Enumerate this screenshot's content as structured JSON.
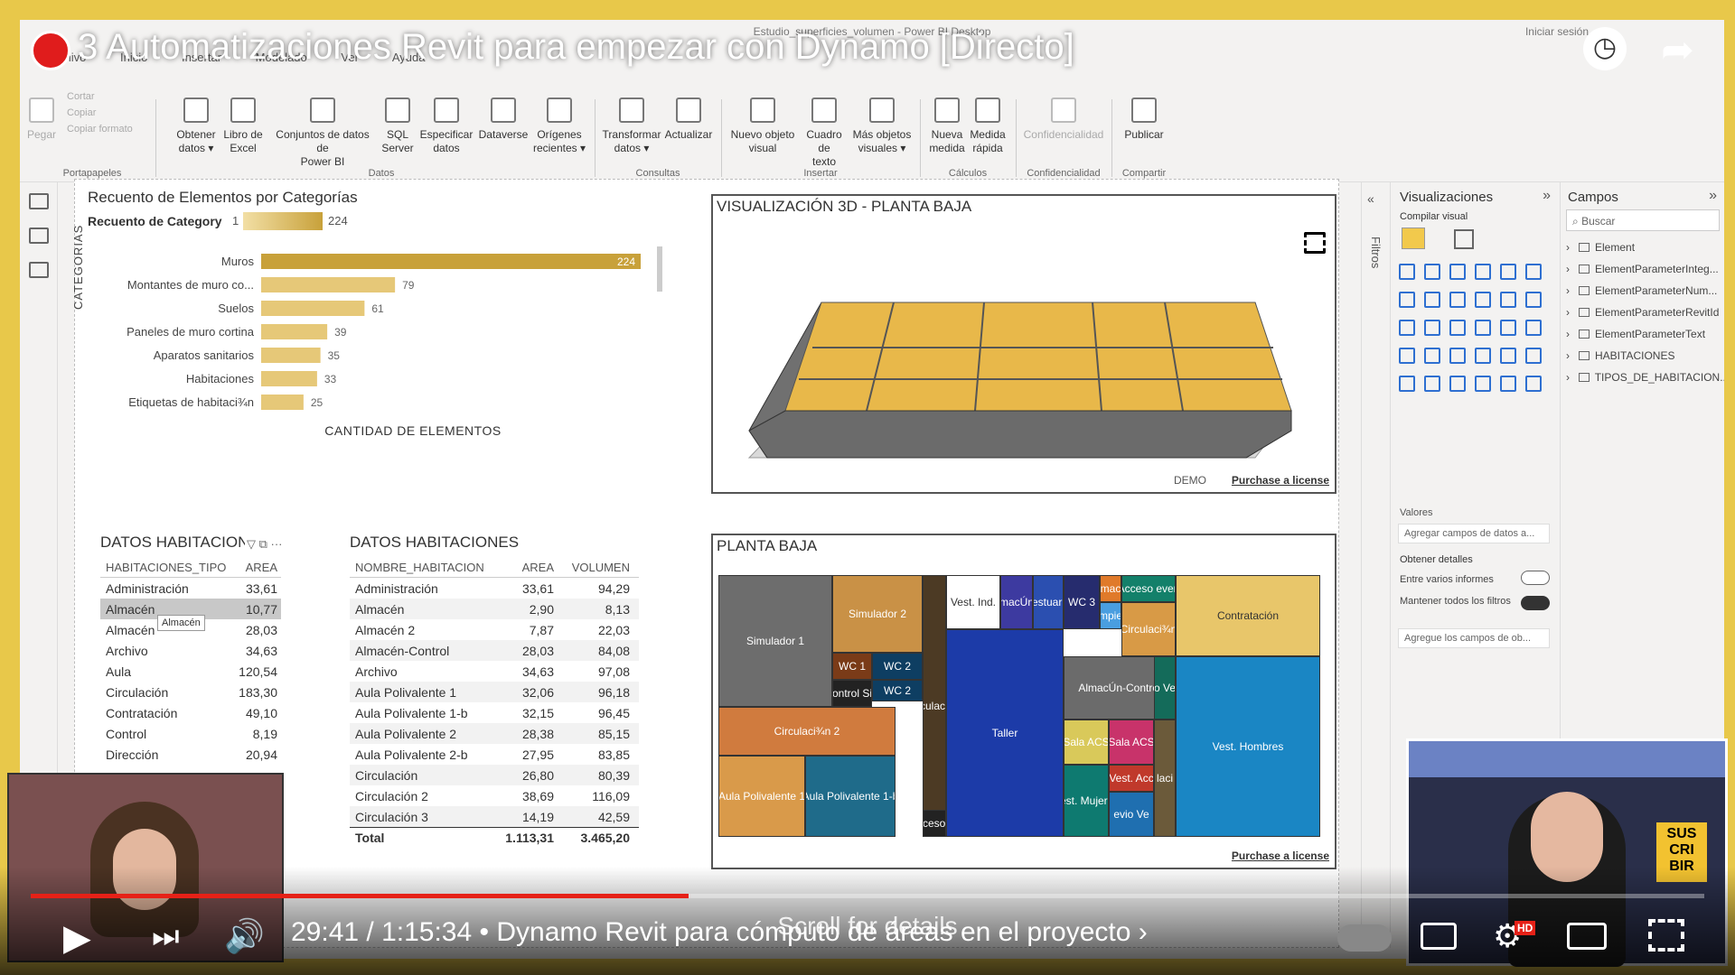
{
  "window": {
    "title": "Estudio_superficies_volumen - Power BI Desktop",
    "session": "Iniciar sesión"
  },
  "menu_tabs": [
    "Archivo",
    "Inicio",
    "Insertar",
    "Modelado",
    "Ver",
    "Ayuda"
  ],
  "ribbon": {
    "clipboard": {
      "paste": "Pegar",
      "cut": "Cortar",
      "copy": "Copiar",
      "format": "Copiar formato",
      "group": "Portapapeles"
    },
    "data": [
      {
        "l1": "Obtener",
        "l2": "datos ▾"
      },
      {
        "l1": "Libro de",
        "l2": "Excel"
      },
      {
        "l1": "Conjuntos de datos de",
        "l2": "Power BI"
      },
      {
        "l1": "SQL",
        "l2": "Server"
      },
      {
        "l1": "Especificar",
        "l2": "datos"
      },
      {
        "l1": "Dataverse",
        "l2": ""
      },
      {
        "l1": "Orígenes",
        "l2": "recientes ▾"
      }
    ],
    "data_group": "Datos",
    "queries": [
      {
        "l1": "Transformar",
        "l2": "datos ▾"
      },
      {
        "l1": "Actualizar",
        "l2": ""
      }
    ],
    "queries_group": "Consultas",
    "insert": [
      {
        "l1": "Nuevo objeto",
        "l2": "visual"
      },
      {
        "l1": "Cuadro de",
        "l2": "texto"
      },
      {
        "l1": "Más objetos",
        "l2": "visuales ▾"
      }
    ],
    "insert_group": "Insertar",
    "calc": [
      {
        "l1": "Nueva",
        "l2": "medida"
      },
      {
        "l1": "Medida",
        "l2": "rápida"
      }
    ],
    "calc_group": "Cálculos",
    "sensitivity": {
      "l1": "Confidencialidad",
      "group": "Confidencialidad"
    },
    "publish": {
      "l1": "Publicar",
      "group": "Compartir"
    }
  },
  "bar_visual": {
    "title": "Recuento de Elementos por Categorías",
    "legend_label": "Recuento de Category",
    "legend_min": "1",
    "legend_max": "224",
    "ylabel": "CATEGORIAS",
    "xlabel": "CANTIDAD DE ELEMENTOS"
  },
  "chart_data": {
    "type": "bar",
    "categories": [
      "Muros",
      "Montantes de muro co...",
      "Suelos",
      "Paneles de muro cortina",
      "Aparatos sanitarios",
      "Habitaciones",
      "Etiquetas de habitaci¾n"
    ],
    "values": [
      224,
      79,
      61,
      39,
      35,
      33,
      25
    ],
    "xticks": [
      "0",
      "50",
      "100",
      "150",
      "200"
    ],
    "xlim": [
      0,
      224
    ],
    "ylabel": "CATEGORIAS",
    "xlabel": "CANTIDAD DE ELEMENTOS",
    "colors": [
      "#c8a13a",
      "#e6c878"
    ]
  },
  "vis3d": {
    "title": "VISUALIZACIÓN 3D - PLANTA BAJA",
    "demo": "DEMO",
    "license": "Purchase a license"
  },
  "planta": {
    "title": "PLANTA BAJA",
    "license": "Purchase a license",
    "rooms": [
      "Simulador 1",
      "Simulador 2",
      "Circulaci¾n 2",
      "Aula Polivalente 1",
      "Aula Polivalente 1-b",
      "WC 1",
      "WC 2",
      "ontrol Si",
      "Circulaci¾n",
      "acceso fo",
      "Vest. Ind.",
      "Taller",
      "macÚn",
      "estuari",
      "WC 3",
      "mac",
      "mpie",
      "Acceso even",
      "Circulaci¾n",
      "Contratación",
      "AlmacÚn-Control",
      "Sala ACS",
      "Vest. Acc",
      "Vest. Mujeres",
      "evio Ve",
      "Vest. Hombres",
      "o Ve",
      "laci",
      "laci"
    ]
  },
  "table1": {
    "title": "DATOS HABITACIONES",
    "headers": [
      "HABITACIONES_TIPO",
      "AREA"
    ],
    "rows": [
      [
        "Administración",
        "33,61"
      ],
      [
        "Almacén",
        "10,77"
      ],
      [
        "Almacén",
        "28,03"
      ],
      [
        "Archivo",
        "34,63"
      ],
      [
        "Aula",
        "120,54"
      ],
      [
        "Circulación",
        "183,30"
      ],
      [
        "Contratación",
        "49,10"
      ],
      [
        "Control",
        "8,19"
      ],
      [
        "Dirección",
        "20,94"
      ]
    ],
    "tooltip": "Almacén"
  },
  "table2": {
    "title": "DATOS HABITACIONES",
    "headers": [
      "NOMBRE_HABITACION",
      "AREA",
      "VOLUMEN"
    ],
    "rows": [
      [
        "Administración",
        "33,61",
        "94,29"
      ],
      [
        "Almacén",
        "2,90",
        "8,13"
      ],
      [
        "Almacén 2",
        "7,87",
        "22,03"
      ],
      [
        "Almacén-Control",
        "28,03",
        "84,08"
      ],
      [
        "Archivo",
        "34,63",
        "97,08"
      ],
      [
        "Aula Polivalente 1",
        "32,06",
        "96,18"
      ],
      [
        "Aula Polivalente 1-b",
        "32,15",
        "96,45"
      ],
      [
        "Aula Polivalente 2",
        "28,38",
        "85,15"
      ],
      [
        "Aula Polivalente 2-b",
        "27,95",
        "83,85"
      ],
      [
        "Circulación",
        "26,80",
        "80,39"
      ],
      [
        "Circulación 2",
        "38,69",
        "116,09"
      ],
      [
        "Circulación 3",
        "14,19",
        "42,59"
      ]
    ],
    "total": [
      "Total",
      "1.113,31",
      "3.465,20"
    ]
  },
  "filters": {
    "label": "Filtros"
  },
  "visualizations": {
    "title": "Visualizaciones",
    "build": "Compilar visual",
    "values": "Valores",
    "values_placeholder": "Agregar campos de datos a...",
    "details": "Obtener detalles",
    "cross_report": "Entre varios informes",
    "keep_filters": "Mantener todos los filtros",
    "drill_placeholder": "Agregue los campos de ob..."
  },
  "fields": {
    "title": "Campos",
    "search_placeholder": "Buscar",
    "tables": [
      "Element",
      "ElementParameterInteg...",
      "ElementParameterNum...",
      "ElementParameterRevitId",
      "ElementParameterText",
      "HABITACIONES",
      "TIPOS_DE_HABITACION..."
    ]
  },
  "youtube": {
    "title": "3 Automatizaciones Revit para empezar con Dynamo [Directo]",
    "time": "29:41 / 1:15:34",
    "chapter": "• Dynamo Revit para cómputo de áreas en el proyecto ›",
    "scroll": "Scroll for details",
    "progress": 0.393,
    "subscribe": "SUS CRI BIR",
    "hd": "HD"
  }
}
